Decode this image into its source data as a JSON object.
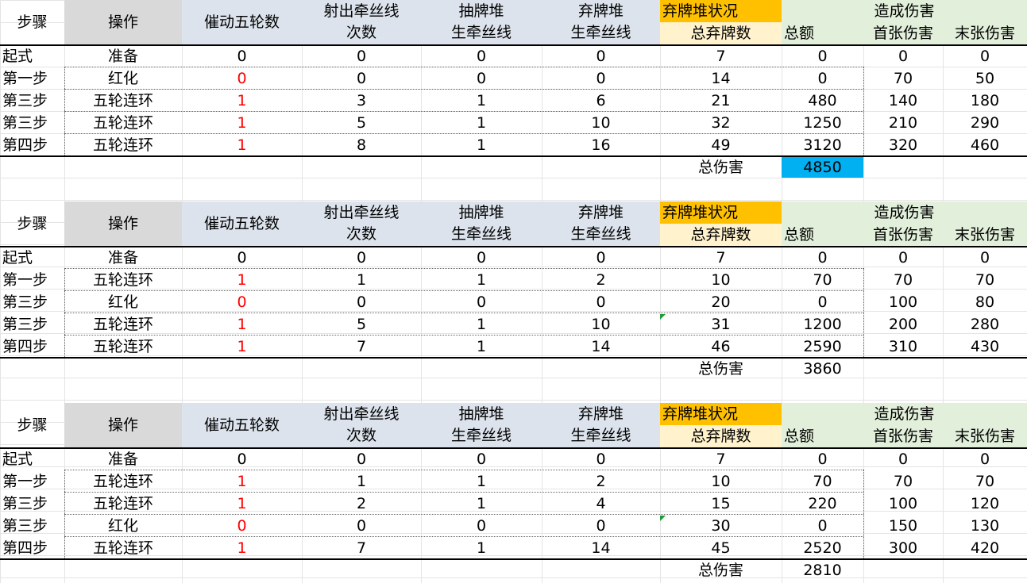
{
  "headers": {
    "step": "步骤",
    "action": "操作",
    "drive": "催动五轮数",
    "shoot_1": "射出牵丝线",
    "shoot_2": "次数",
    "draw_1": "抽牌堆",
    "draw_2": "生牵丝线",
    "discard_1": "弃牌堆",
    "discard_2": "生牵丝线",
    "pile_status": "弃牌堆状况",
    "pile_total": "总弃牌数",
    "damage_group": "造成伤害",
    "total": "总额",
    "first": "首张伤害",
    "last": "末张伤害"
  },
  "total_label": "总伤害",
  "colors": {
    "header_gray": "#d9d9d9",
    "header_blue": "#dce3ec",
    "header_orange": "#ffc000",
    "header_light_orange": "#fff2cc",
    "header_green": "#e2efda",
    "highlight": "#00b0f0",
    "drive_red": "#ff0000"
  },
  "tables": [
    {
      "rows": [
        [
          "起式",
          "准备",
          "0",
          "0",
          "0",
          "0",
          "7",
          "0",
          "0",
          "0"
        ],
        [
          "第一步",
          "红化",
          "0",
          "0",
          "0",
          "0",
          "14",
          "0",
          "70",
          "50"
        ],
        [
          "第三步",
          "五轮连环",
          "1",
          "3",
          "1",
          "6",
          "21",
          "480",
          "140",
          "180"
        ],
        [
          "第三步",
          "五轮连环",
          "1",
          "5",
          "1",
          "10",
          "32",
          "1250",
          "210",
          "290"
        ],
        [
          "第四步",
          "五轮连环",
          "1",
          "8",
          "1",
          "16",
          "49",
          "3120",
          "320",
          "460"
        ]
      ],
      "total": "4850",
      "highlight_total": true
    },
    {
      "rows": [
        [
          "起式",
          "准备",
          "0",
          "0",
          "0",
          "0",
          "7",
          "0",
          "0",
          "0"
        ],
        [
          "第一步",
          "五轮连环",
          "1",
          "1",
          "1",
          "2",
          "10",
          "70",
          "70",
          "70"
        ],
        [
          "第三步",
          "红化",
          "0",
          "0",
          "0",
          "0",
          "20",
          "0",
          "100",
          "80"
        ],
        [
          "第三步",
          "五轮连环",
          "1",
          "5",
          "1",
          "10",
          "31",
          "1200",
          "200",
          "280"
        ],
        [
          "第四步",
          "五轮连环",
          "1",
          "7",
          "1",
          "14",
          "46",
          "2590",
          "310",
          "430"
        ]
      ],
      "total": "3860",
      "highlight_total": false
    },
    {
      "rows": [
        [
          "起式",
          "准备",
          "0",
          "0",
          "0",
          "0",
          "7",
          "0",
          "0",
          "0"
        ],
        [
          "第一步",
          "五轮连环",
          "1",
          "1",
          "1",
          "2",
          "10",
          "70",
          "70",
          "70"
        ],
        [
          "第三步",
          "五轮连环",
          "1",
          "2",
          "1",
          "4",
          "15",
          "220",
          "100",
          "120"
        ],
        [
          "第三步",
          "红化",
          "0",
          "0",
          "0",
          "0",
          "30",
          "0",
          "150",
          "130"
        ],
        [
          "第四步",
          "五轮连环",
          "1",
          "7",
          "1",
          "14",
          "45",
          "2520",
          "300",
          "420"
        ]
      ],
      "total": "2810",
      "highlight_total": false
    }
  ]
}
